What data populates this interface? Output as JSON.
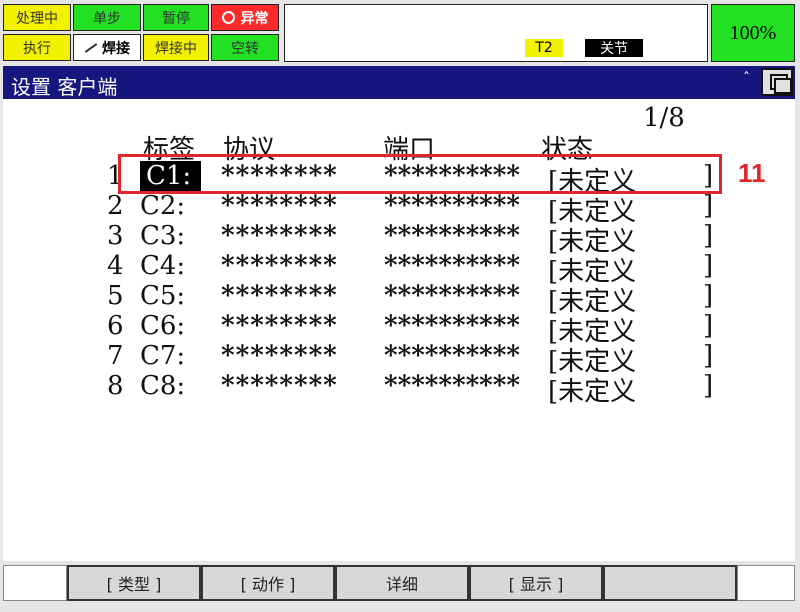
{
  "status": {
    "row1": [
      "处理中",
      "单步",
      "暂停"
    ],
    "alarm": "异常",
    "row2": [
      "执行",
      "焊接",
      "焊接中",
      "空转"
    ]
  },
  "center": {
    "tool": "T2",
    "coord": "关节"
  },
  "speed": "100%",
  "window": {
    "title": "设置 客户端",
    "caret": "ˆ"
  },
  "table": {
    "page": "1/8",
    "headers": {
      "label": "标签",
      "protocol": "协议",
      "port": "端口",
      "status": "状态"
    },
    "rows": [
      {
        "index": "1",
        "label": "C1:",
        "protocol": "********",
        "port": "**********",
        "status": "[未定义",
        "close": "]"
      },
      {
        "index": "2",
        "label": "C2:",
        "protocol": "********",
        "port": "**********",
        "status": "[未定义",
        "close": "]"
      },
      {
        "index": "3",
        "label": "C3:",
        "protocol": "********",
        "port": "**********",
        "status": "[未定义",
        "close": "]"
      },
      {
        "index": "4",
        "label": "C4:",
        "protocol": "********",
        "port": "**********",
        "status": "[未定义",
        "close": "]"
      },
      {
        "index": "5",
        "label": "C5:",
        "protocol": "********",
        "port": "**********",
        "status": "[未定义",
        "close": "]"
      },
      {
        "index": "6",
        "label": "C6:",
        "protocol": "********",
        "port": "**********",
        "status": "[未定义",
        "close": "]"
      },
      {
        "index": "7",
        "label": "C7:",
        "protocol": "********",
        "port": "**********",
        "status": "[未定义",
        "close": "]"
      },
      {
        "index": "8",
        "label": "C8:",
        "protocol": "********",
        "port": "**********",
        "status": "[未定义",
        "close": "]"
      }
    ]
  },
  "annotation": {
    "number": "11",
    "color": "#e0262a"
  },
  "fkeys": [
    "[ 类型 ]",
    "[ 动作 ]",
    "详细",
    "[ 显示 ]",
    ""
  ],
  "colors": {
    "title_bar": "#16167e",
    "yellow": "#f2f200",
    "green": "#22e022",
    "red": "#ff2a2a"
  }
}
